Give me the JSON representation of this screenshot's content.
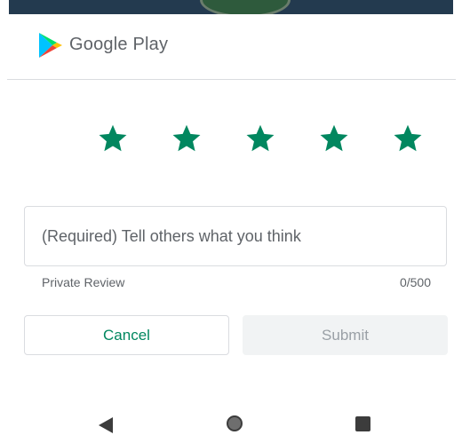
{
  "app": {
    "brand_name": "Google Play",
    "logo_icon": "google-play-icon"
  },
  "rating": {
    "max_stars": 5,
    "selected_stars": 5,
    "star_color": "#01875f",
    "star_icon": "star-icon"
  },
  "review": {
    "placeholder": "(Required) Tell others what you think",
    "value": "",
    "privacy_label": "Private Review",
    "char_counter": "0/500"
  },
  "actions": {
    "cancel_label": "Cancel",
    "submit_label": "Submit"
  },
  "colors": {
    "accent": "#01875f",
    "disabled_bg": "#f1f3f4",
    "disabled_text": "#9aa0a6",
    "top_strip": "#233a4f"
  },
  "system_nav": {
    "back_icon": "back-triangle-icon",
    "home_icon": "home-circle-icon",
    "recents_icon": "recents-square-icon"
  }
}
